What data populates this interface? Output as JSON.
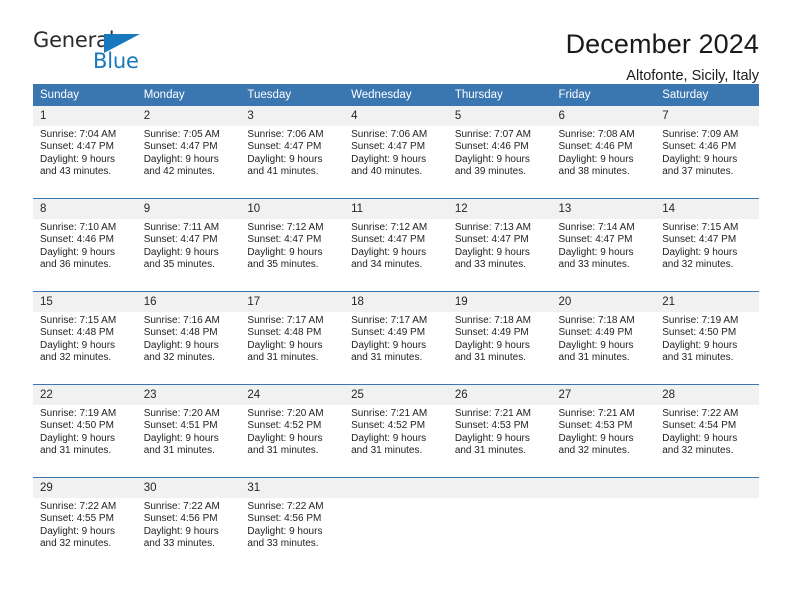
{
  "brand": {
    "name_top": "General",
    "name_bottom": "Blue",
    "accent_color": "#1878be",
    "triangle_icon": "triangle-icon"
  },
  "header": {
    "title": "December 2024",
    "subtitle": "Altofonte, Sicily, Italy"
  },
  "calendar": {
    "header_bg": "#3a76af",
    "daynum_bg": "#f1f1f1",
    "weekdays": [
      "Sunday",
      "Monday",
      "Tuesday",
      "Wednesday",
      "Thursday",
      "Friday",
      "Saturday"
    ],
    "weeks": [
      {
        "days": [
          {
            "num": "1",
            "sunrise": "Sunrise: 7:04 AM",
            "sunset": "Sunset: 4:47 PM",
            "daylight1": "Daylight: 9 hours",
            "daylight2": "and 43 minutes."
          },
          {
            "num": "2",
            "sunrise": "Sunrise: 7:05 AM",
            "sunset": "Sunset: 4:47 PM",
            "daylight1": "Daylight: 9 hours",
            "daylight2": "and 42 minutes."
          },
          {
            "num": "3",
            "sunrise": "Sunrise: 7:06 AM",
            "sunset": "Sunset: 4:47 PM",
            "daylight1": "Daylight: 9 hours",
            "daylight2": "and 41 minutes."
          },
          {
            "num": "4",
            "sunrise": "Sunrise: 7:06 AM",
            "sunset": "Sunset: 4:47 PM",
            "daylight1": "Daylight: 9 hours",
            "daylight2": "and 40 minutes."
          },
          {
            "num": "5",
            "sunrise": "Sunrise: 7:07 AM",
            "sunset": "Sunset: 4:46 PM",
            "daylight1": "Daylight: 9 hours",
            "daylight2": "and 39 minutes."
          },
          {
            "num": "6",
            "sunrise": "Sunrise: 7:08 AM",
            "sunset": "Sunset: 4:46 PM",
            "daylight1": "Daylight: 9 hours",
            "daylight2": "and 38 minutes."
          },
          {
            "num": "7",
            "sunrise": "Sunrise: 7:09 AM",
            "sunset": "Sunset: 4:46 PM",
            "daylight1": "Daylight: 9 hours",
            "daylight2": "and 37 minutes."
          }
        ]
      },
      {
        "days": [
          {
            "num": "8",
            "sunrise": "Sunrise: 7:10 AM",
            "sunset": "Sunset: 4:46 PM",
            "daylight1": "Daylight: 9 hours",
            "daylight2": "and 36 minutes."
          },
          {
            "num": "9",
            "sunrise": "Sunrise: 7:11 AM",
            "sunset": "Sunset: 4:47 PM",
            "daylight1": "Daylight: 9 hours",
            "daylight2": "and 35 minutes."
          },
          {
            "num": "10",
            "sunrise": "Sunrise: 7:12 AM",
            "sunset": "Sunset: 4:47 PM",
            "daylight1": "Daylight: 9 hours",
            "daylight2": "and 35 minutes."
          },
          {
            "num": "11",
            "sunrise": "Sunrise: 7:12 AM",
            "sunset": "Sunset: 4:47 PM",
            "daylight1": "Daylight: 9 hours",
            "daylight2": "and 34 minutes."
          },
          {
            "num": "12",
            "sunrise": "Sunrise: 7:13 AM",
            "sunset": "Sunset: 4:47 PM",
            "daylight1": "Daylight: 9 hours",
            "daylight2": "and 33 minutes."
          },
          {
            "num": "13",
            "sunrise": "Sunrise: 7:14 AM",
            "sunset": "Sunset: 4:47 PM",
            "daylight1": "Daylight: 9 hours",
            "daylight2": "and 33 minutes."
          },
          {
            "num": "14",
            "sunrise": "Sunrise: 7:15 AM",
            "sunset": "Sunset: 4:47 PM",
            "daylight1": "Daylight: 9 hours",
            "daylight2": "and 32 minutes."
          }
        ]
      },
      {
        "days": [
          {
            "num": "15",
            "sunrise": "Sunrise: 7:15 AM",
            "sunset": "Sunset: 4:48 PM",
            "daylight1": "Daylight: 9 hours",
            "daylight2": "and 32 minutes."
          },
          {
            "num": "16",
            "sunrise": "Sunrise: 7:16 AM",
            "sunset": "Sunset: 4:48 PM",
            "daylight1": "Daylight: 9 hours",
            "daylight2": "and 32 minutes."
          },
          {
            "num": "17",
            "sunrise": "Sunrise: 7:17 AM",
            "sunset": "Sunset: 4:48 PM",
            "daylight1": "Daylight: 9 hours",
            "daylight2": "and 31 minutes."
          },
          {
            "num": "18",
            "sunrise": "Sunrise: 7:17 AM",
            "sunset": "Sunset: 4:49 PM",
            "daylight1": "Daylight: 9 hours",
            "daylight2": "and 31 minutes."
          },
          {
            "num": "19",
            "sunrise": "Sunrise: 7:18 AM",
            "sunset": "Sunset: 4:49 PM",
            "daylight1": "Daylight: 9 hours",
            "daylight2": "and 31 minutes."
          },
          {
            "num": "20",
            "sunrise": "Sunrise: 7:18 AM",
            "sunset": "Sunset: 4:49 PM",
            "daylight1": "Daylight: 9 hours",
            "daylight2": "and 31 minutes."
          },
          {
            "num": "21",
            "sunrise": "Sunrise: 7:19 AM",
            "sunset": "Sunset: 4:50 PM",
            "daylight1": "Daylight: 9 hours",
            "daylight2": "and 31 minutes."
          }
        ]
      },
      {
        "days": [
          {
            "num": "22",
            "sunrise": "Sunrise: 7:19 AM",
            "sunset": "Sunset: 4:50 PM",
            "daylight1": "Daylight: 9 hours",
            "daylight2": "and 31 minutes."
          },
          {
            "num": "23",
            "sunrise": "Sunrise: 7:20 AM",
            "sunset": "Sunset: 4:51 PM",
            "daylight1": "Daylight: 9 hours",
            "daylight2": "and 31 minutes."
          },
          {
            "num": "24",
            "sunrise": "Sunrise: 7:20 AM",
            "sunset": "Sunset: 4:52 PM",
            "daylight1": "Daylight: 9 hours",
            "daylight2": "and 31 minutes."
          },
          {
            "num": "25",
            "sunrise": "Sunrise: 7:21 AM",
            "sunset": "Sunset: 4:52 PM",
            "daylight1": "Daylight: 9 hours",
            "daylight2": "and 31 minutes."
          },
          {
            "num": "26",
            "sunrise": "Sunrise: 7:21 AM",
            "sunset": "Sunset: 4:53 PM",
            "daylight1": "Daylight: 9 hours",
            "daylight2": "and 31 minutes."
          },
          {
            "num": "27",
            "sunrise": "Sunrise: 7:21 AM",
            "sunset": "Sunset: 4:53 PM",
            "daylight1": "Daylight: 9 hours",
            "daylight2": "and 32 minutes."
          },
          {
            "num": "28",
            "sunrise": "Sunrise: 7:22 AM",
            "sunset": "Sunset: 4:54 PM",
            "daylight1": "Daylight: 9 hours",
            "daylight2": "and 32 minutes."
          }
        ]
      },
      {
        "days": [
          {
            "num": "29",
            "sunrise": "Sunrise: 7:22 AM",
            "sunset": "Sunset: 4:55 PM",
            "daylight1": "Daylight: 9 hours",
            "daylight2": "and 32 minutes."
          },
          {
            "num": "30",
            "sunrise": "Sunrise: 7:22 AM",
            "sunset": "Sunset: 4:56 PM",
            "daylight1": "Daylight: 9 hours",
            "daylight2": "and 33 minutes."
          },
          {
            "num": "31",
            "sunrise": "Sunrise: 7:22 AM",
            "sunset": "Sunset: 4:56 PM",
            "daylight1": "Daylight: 9 hours",
            "daylight2": "and 33 minutes."
          },
          {
            "num": "",
            "sunrise": "",
            "sunset": "",
            "daylight1": "",
            "daylight2": ""
          },
          {
            "num": "",
            "sunrise": "",
            "sunset": "",
            "daylight1": "",
            "daylight2": ""
          },
          {
            "num": "",
            "sunrise": "",
            "sunset": "",
            "daylight1": "",
            "daylight2": ""
          },
          {
            "num": "",
            "sunrise": "",
            "sunset": "",
            "daylight1": "",
            "daylight2": ""
          }
        ]
      }
    ]
  }
}
